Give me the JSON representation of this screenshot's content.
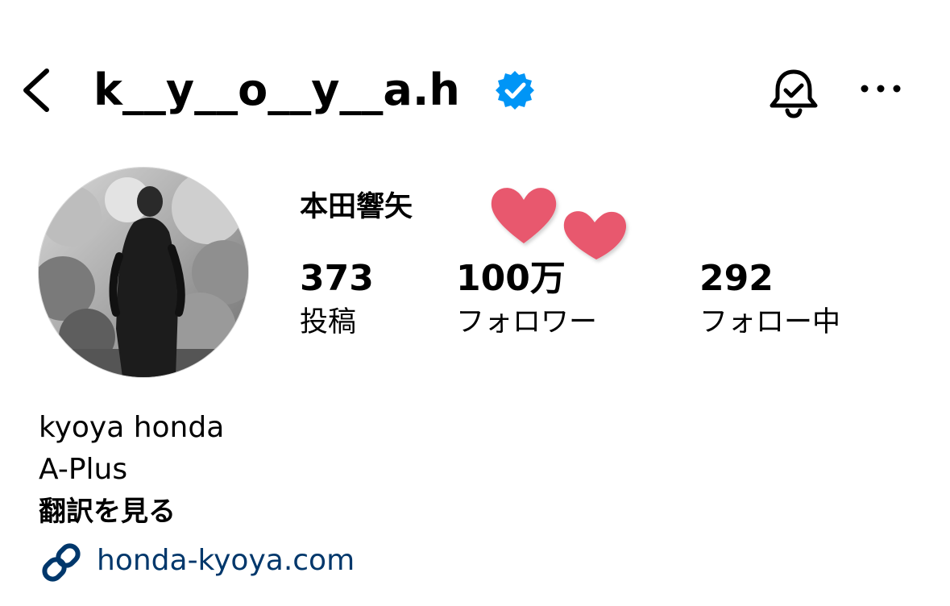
{
  "header": {
    "username": "k__y__o__y__a.h",
    "icons": [
      "back-arrow-icon",
      "verified-badge-icon",
      "bell-notification-icon",
      "more-options-icon"
    ]
  },
  "profile": {
    "display_name": "本田響矢",
    "avatar_icon": "profile-photo"
  },
  "stats": {
    "posts": {
      "value": "373",
      "label": "投稿"
    },
    "followers": {
      "value": "100万",
      "label": "フォロワー"
    },
    "following": {
      "value": "292",
      "label": "フォロー中"
    }
  },
  "bio": {
    "name": "kyoya honda",
    "agency": "A-Plus",
    "translate_label": "翻訳を見る",
    "link": "honda-kyoya.com"
  },
  "colors": {
    "verified_blue": "#0095f6",
    "link_blue": "#00376b",
    "heart_pink": "#e8586e",
    "text": "#000000",
    "background": "#ffffff"
  }
}
